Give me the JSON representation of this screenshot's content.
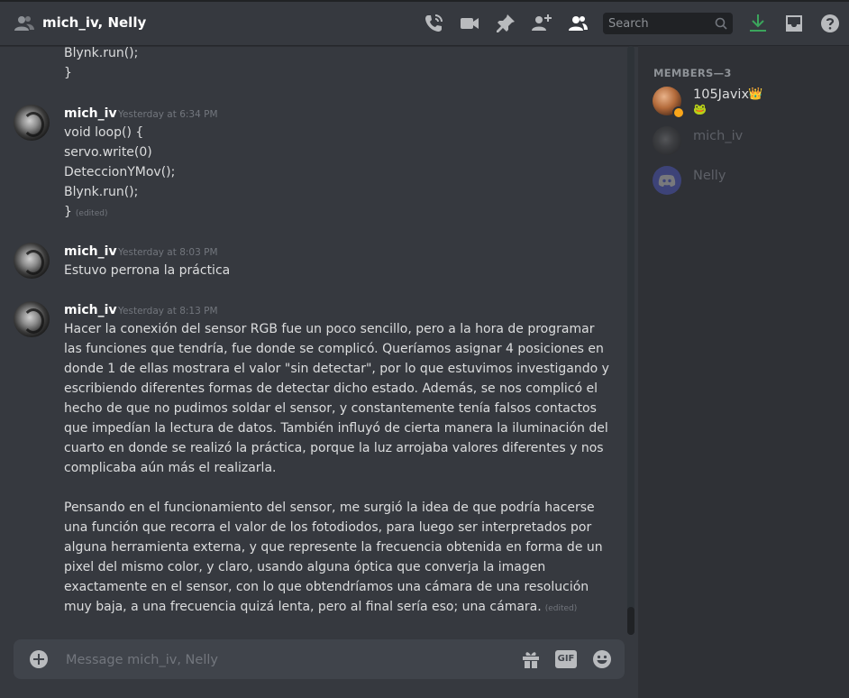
{
  "header": {
    "title": "mich_iv, Nelly",
    "search_placeholder": "Search"
  },
  "colors": {
    "accent_green": "#3ba55c",
    "crown": "#faa61a",
    "blurple": "#5865f2"
  },
  "messages": {
    "top_lines": [
      "Blynk.run();",
      "}"
    ],
    "groups": [
      {
        "author": "mich_iv",
        "timestamp": "Yesterday at 6:34 PM",
        "lines": [
          "void loop() {",
          "servo.write(0)",
          "DeteccionYMov();",
          "Blynk.run();",
          "}"
        ],
        "edited": "(edited)"
      },
      {
        "author": "mich_iv",
        "timestamp": "Yesterday at 8:03 PM",
        "lines": [
          "Estuvo perrona la práctica"
        ]
      },
      {
        "author": "mich_iv",
        "timestamp": "Yesterday at 8:13 PM",
        "lines": [
          "Hacer la conexión del sensor RGB fue un poco sencillo, pero a la hora de programar",
          "las funciones que tendría, fue donde se complicó. Queríamos asignar 4 posiciones en",
          "donde 1 de ellas mostrara el valor \"sin detectar\", por lo que estuvimos investigando y",
          "escribiendo diferentes formas de detectar dicho estado. Además, se nos complicó el",
          "hecho de que no pudimos soldar el sensor, y constantemente tenía falsos contactos",
          "que impedían la lectura de datos. También influyó de cierta manera la iluminación del",
          "cuarto en donde se realizó la práctica, porque la luz arrojaba valores diferentes y nos",
          "complicaba aún más el realizarla.",
          "",
          "Pensando en el funcionamiento del sensor, me surgió la idea de que podría hacerse",
          "una función que recorra el valor de los fotodiodos, para luego ser interpretados por",
          "alguna herramienta externa, y que represente la frecuencia obtenida en forma de un",
          "pixel del mismo color, y claro, usando alguna óptica que converja la imagen",
          "exactamente en el sensor, con lo que obtendríamos una cámara de una resolución",
          "muy baja, a una frecuencia quizá lenta, pero al final sería eso; una cámara."
        ],
        "edited": "(edited)"
      }
    ]
  },
  "composer": {
    "placeholder": "Message mich_iv, Nelly",
    "gif_label": "GIF"
  },
  "members": {
    "heading": "MEMBERS—3",
    "list": [
      {
        "name": "105Javix",
        "color": "#dcddde",
        "badge": "👑",
        "status_emoji": "🐸"
      },
      {
        "name": "mich_iv",
        "color": "#5d6067"
      },
      {
        "name": "Nelly",
        "color": "#5d6067"
      }
    ]
  }
}
